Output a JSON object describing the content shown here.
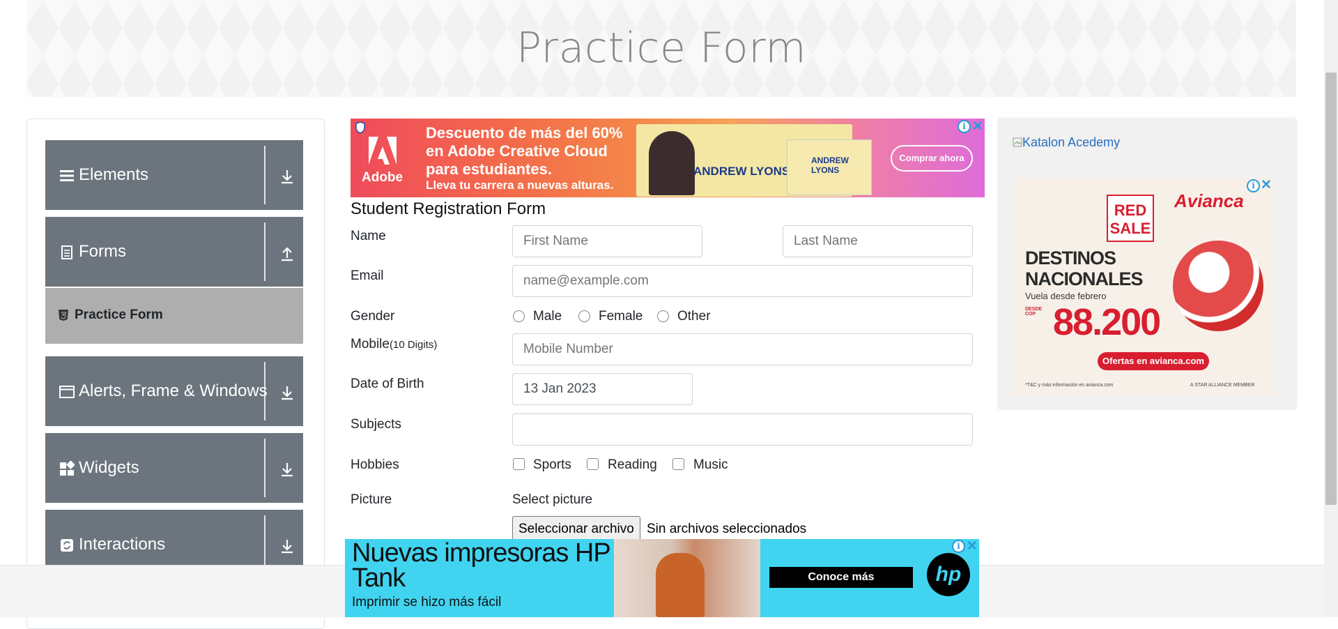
{
  "page": {
    "title": "Practice Form"
  },
  "sidebar": {
    "groups": [
      {
        "label": "Elements",
        "icon": "list-icon",
        "arrow": "download-icon"
      },
      {
        "label": "Forms",
        "icon": "document-icon",
        "arrow": "upload-icon"
      },
      {
        "label": "Alerts, Frame & Windows",
        "icon": "window-icon",
        "arrow": "download-icon"
      },
      {
        "label": "Widgets",
        "icon": "widgets-icon",
        "arrow": "download-icon"
      },
      {
        "label": "Interactions",
        "icon": "refresh-icon",
        "arrow": "download-icon"
      }
    ],
    "active_item": {
      "label": "Practice Form",
      "icon": "html5-icon"
    }
  },
  "ads": {
    "top": {
      "brand": "Adobe",
      "headline": "Descuento de más del 60% en Adobe Creative Cloud para estudiantes.",
      "subline": "Lleva tu carrera a nuevas alturas.",
      "name1": "ANDREW LYONS",
      "name2": "ANDREW LYONS",
      "cta": "Comprar ahora"
    },
    "right": {
      "broken_image_alt": "Katalon Acedemy",
      "sale": "RED SALE",
      "brand": "Avianca",
      "headline": "DESTINOS NACIONALES",
      "sub": "Vuela desde febrero",
      "desde": "DESDE COP",
      "price": "88.200",
      "cta": "Ofertas en avianca.com",
      "foot": "*T&C y más información en avianca.com",
      "foot2": "A STAR ALLIANCE MEMBER"
    },
    "bottom": {
      "headline": "Nuevas impresoras HP Tank",
      "sub": "Imprimir se hizo más fácil",
      "cta": "Conoce más",
      "logo": "hp"
    },
    "info_glyph": "i",
    "close_glyph": "✕"
  },
  "form": {
    "title": "Student Registration Form",
    "name_label": "Name",
    "first_name_placeholder": "First Name",
    "last_name_placeholder": "Last Name",
    "email_label": "Email",
    "email_placeholder": "name@example.com",
    "gender_label": "Gender",
    "gender_options": [
      "Male",
      "Female",
      "Other"
    ],
    "mobile_label": "Mobile",
    "mobile_hint": "(10 Digits)",
    "mobile_placeholder": "Mobile Number",
    "dob_label": "Date of Birth",
    "dob_value": "13 Jan 2023",
    "subjects_label": "Subjects",
    "hobbies_label": "Hobbies",
    "hobbies_options": [
      "Sports",
      "Reading",
      "Music"
    ],
    "picture_label": "Picture",
    "select_picture": "Select picture",
    "file_button": "Seleccionar archivo",
    "file_status": "Sin archivos seleccionados"
  },
  "colors": {
    "sidebar_group": "#6c757d",
    "active_item": "#aeaeae",
    "link": "#2a6ebd"
  }
}
